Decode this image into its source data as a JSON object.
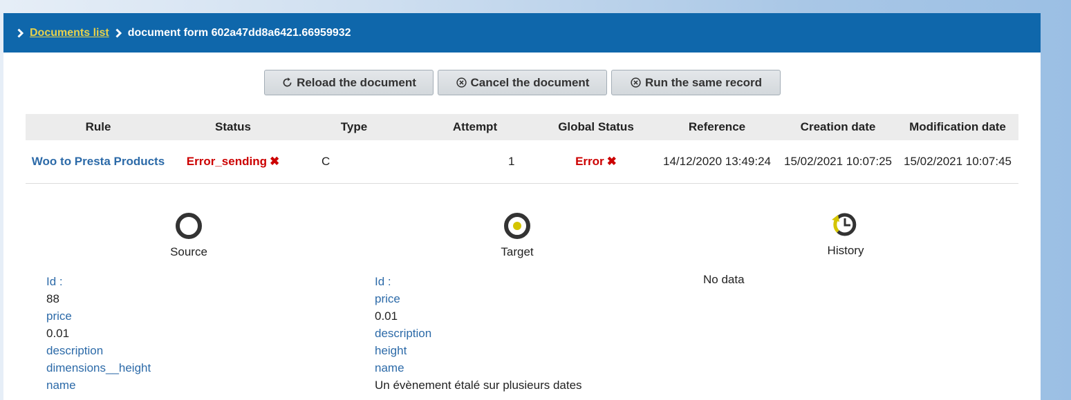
{
  "breadcrumb": {
    "link": "Documents list",
    "current": "document form 602a47dd8a6421.66959932"
  },
  "buttons": {
    "reload": "Reload the document",
    "cancel": "Cancel the document",
    "run": "Run the same record"
  },
  "table": {
    "headers": [
      "Rule",
      "Status",
      "Type",
      "Attempt",
      "Global Status",
      "Reference",
      "Creation date",
      "Modification date"
    ],
    "row": {
      "rule": "Woo to Presta Products",
      "status": "Error_sending",
      "type": "C",
      "attempt": "1",
      "global_status": "Error",
      "reference": "14/12/2020 13:49:24",
      "creation": "15/02/2021 10:07:25",
      "modification": "15/02/2021 10:07:45"
    }
  },
  "tabs": {
    "source": "Source",
    "target": "Target",
    "history": "History"
  },
  "source_fields": [
    {
      "key": "Id :",
      "value": "88"
    },
    {
      "key": "price",
      "value": "0.01"
    },
    {
      "key": "description",
      "value": ""
    },
    {
      "key": "dimensions__height",
      "value": ""
    },
    {
      "key": "name",
      "value": ""
    }
  ],
  "target_fields": [
    {
      "key": "Id :",
      "value": ""
    },
    {
      "key": "price",
      "value": "0.01"
    },
    {
      "key": "description",
      "value": ""
    },
    {
      "key": "height",
      "value": ""
    },
    {
      "key": "name",
      "value": "Un évènement étalé sur plusieurs dates"
    }
  ],
  "history": {
    "empty": "No data"
  },
  "colors": {
    "header_bg": "#0f67ab",
    "link_yellow": "#e8d24a",
    "error_red": "#cc0000",
    "link_blue": "#2c6aa8",
    "target_dot": "#d4c400"
  }
}
